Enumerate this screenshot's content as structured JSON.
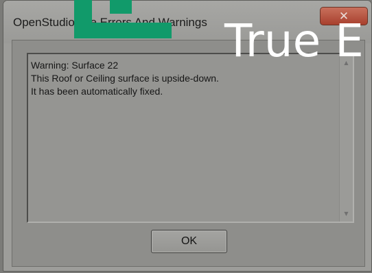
{
  "window": {
    "title": "OpenStudio File Errors And Warnings",
    "close_symbol": "✕"
  },
  "message": {
    "lines": [
      "Warning:  Surface 22",
      "This Roof or Ceiling surface is upside-down.",
      "It has been automatically fixed."
    ]
  },
  "scrollbar": {
    "up_arrow": "▲",
    "down_arrow": "▼"
  },
  "buttons": {
    "ok_label": "OK"
  },
  "watermark": {
    "text": "True E",
    "logo_color": "#119a6a"
  },
  "colors": {
    "dialog_bg": "#9d9d9a",
    "close_button": "#b8513d"
  }
}
